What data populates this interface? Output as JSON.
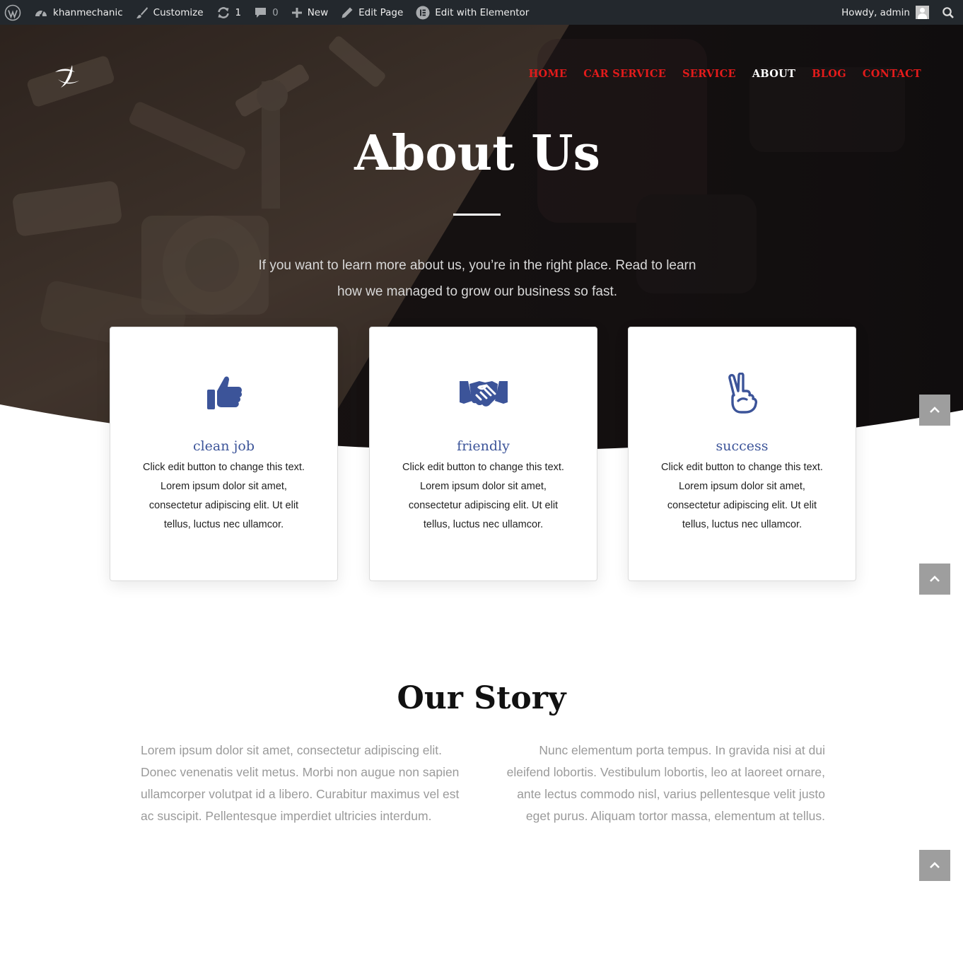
{
  "admin_bar": {
    "site_name": "khanmechanic",
    "customize": "Customize",
    "updates_count": "1",
    "comments_count": "0",
    "new": "New",
    "edit_page": "Edit Page",
    "edit_elementor": "Edit with Elementor",
    "howdy": "Howdy, admin"
  },
  "header": {
    "logo_icon": "khanmechanic-logo-icon",
    "nav": [
      {
        "label": "HOME",
        "active": false
      },
      {
        "label": "CAR SERVICE",
        "active": false
      },
      {
        "label": "SERVICE",
        "active": false
      },
      {
        "label": "ABOUT",
        "active": true
      },
      {
        "label": "BLOG",
        "active": false
      },
      {
        "label": "CONTACT",
        "active": false
      }
    ]
  },
  "hero": {
    "title": "About Us",
    "subtitle": "If you want to learn more about us, you’re in the right place. Read to learn how we managed to grow our business so fast."
  },
  "features": [
    {
      "icon": "thumbs-up-icon",
      "title": "clean job",
      "text": "Click edit button to change this text. Lorem ipsum dolor sit amet, consectetur adipiscing elit. Ut elit tellus, luctus nec ullamcor."
    },
    {
      "icon": "handshake-icon",
      "title": "friendly",
      "text": "Click edit button to change this text. Lorem ipsum dolor sit amet, consectetur adipiscing elit. Ut elit tellus, luctus nec ullamcor."
    },
    {
      "icon": "victory-hand-icon",
      "title": "success",
      "text": "Click edit button to change this text. Lorem ipsum dolor sit amet, consectetur adipiscing elit. Ut elit tellus, luctus nec ullamcor."
    }
  ],
  "story": {
    "title": "Our Story",
    "left": "Lorem ipsum dolor sit amet, consectetur adipiscing elit. Donec venenatis velit metus. Morbi non augue non sapien ullamcorper volutpat id a libero. Curabitur maximus vel est ac suscipit. Pellentesque imperdiet ultricies interdum.",
    "right": "Nunc elementum porta tempus. In gravida nisi at dui eleifend lobortis. Vestibulum lobortis, leo at laoreet ornare, ante lectus commodo nisl, varius pellentesque velit justo eget purus. Aliquam tortor massa, elementum at tellus."
  },
  "colors": {
    "admin_bar_bg": "#23282d",
    "nav_link": "#e31b1b",
    "nav_active": "#ffffff",
    "accent_blue": "#3c5499",
    "scroll_top_bg": "#9e9e9e"
  }
}
